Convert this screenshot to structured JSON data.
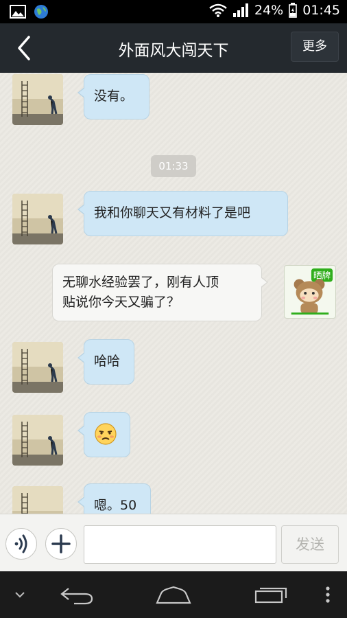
{
  "status_bar": {
    "battery": "24%",
    "time": "01:45"
  },
  "header": {
    "title": "外面风大闯天下",
    "more_label": "更多"
  },
  "chat": {
    "timestamp": "01:33",
    "messages": [
      {
        "side": "left",
        "text": "没有。"
      },
      {
        "side": "left",
        "text": "我和你聊天又有材料了是吧"
      },
      {
        "side": "right",
        "line1": "无聊水经验罢了，刚有人顶",
        "line2": "贴说你今天又骗了？"
      },
      {
        "side": "left",
        "text": "哈哈"
      },
      {
        "side": "left",
        "emoji": "annoyed-face-emoji"
      },
      {
        "side": "left",
        "text": "嗯。50"
      }
    ]
  },
  "input_bar": {
    "send_label": "发送",
    "text_value": ""
  },
  "colors": {
    "header_bg": "#24292e",
    "bubble_in": "#cfe7f6",
    "bubble_out": "#f7f7f5",
    "sticker_label_bg": "#2fae1c"
  },
  "sticker": {
    "label": "晒牌"
  }
}
